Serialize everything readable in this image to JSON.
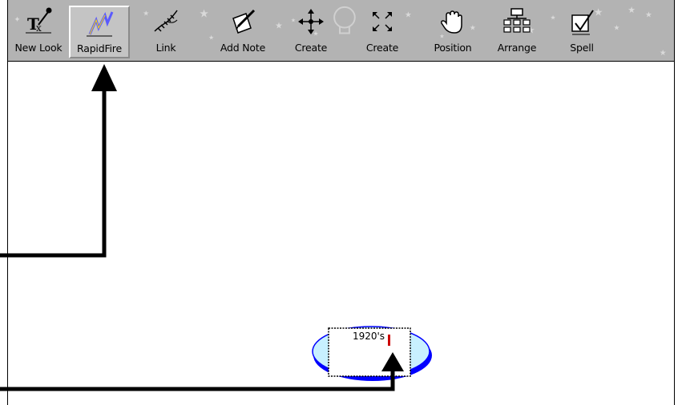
{
  "toolbar": {
    "buttons": [
      {
        "label": "New Look",
        "icon": "tx-pen-icon"
      },
      {
        "label": "RapidFire",
        "icon": "lightning-icon"
      },
      {
        "label": "Link",
        "icon": "link-quill-icon"
      },
      {
        "label": "Add Note",
        "icon": "note-pencil-icon"
      },
      {
        "label": "Create",
        "icon": "four-arrows-icon"
      },
      {
        "label": "Create",
        "icon": "expand-corners-icon"
      },
      {
        "label": "Position",
        "icon": "hand-icon"
      },
      {
        "label": "Arrange",
        "icon": "hierarchy-icon"
      },
      {
        "label": "Spell",
        "icon": "checkbox-check-icon"
      }
    ],
    "selected": "RapidFire",
    "background_color": "#b3b3b3"
  },
  "canvas": {
    "node": {
      "text": "1920's",
      "shape": "oval",
      "fill": "#c8f0ff",
      "border": "#0000ff"
    }
  },
  "annotations": {
    "arrows": [
      "arrow-to-rapidfire",
      "arrow-to-node-cursor"
    ],
    "color": "#000000"
  }
}
